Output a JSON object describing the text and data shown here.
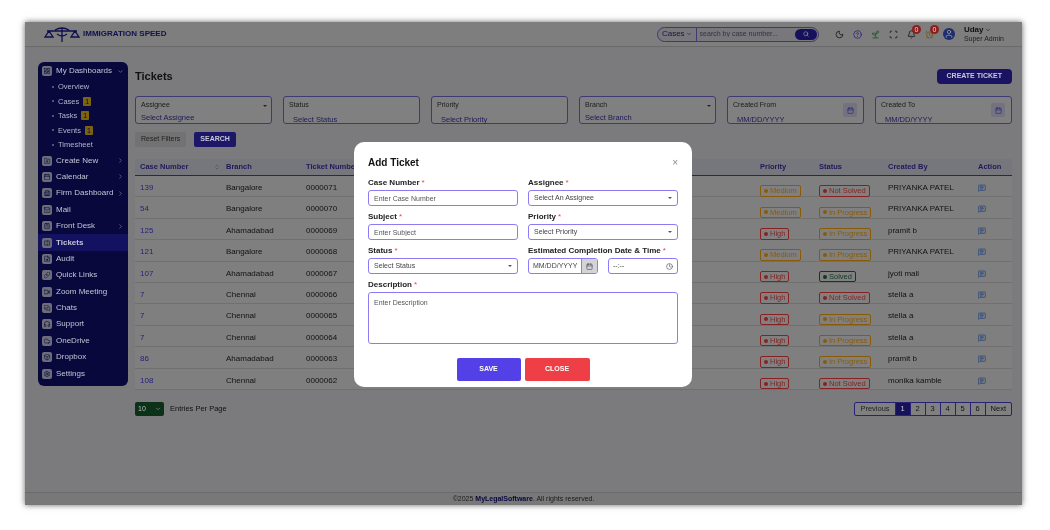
{
  "header": {
    "logo_text": "IMMIGRATION SPEED",
    "search": {
      "scope": "Cases",
      "placeholder": "search by case number..."
    },
    "notifications": {
      "bell_count": "0",
      "clock_count": "0"
    },
    "user": {
      "name": "Uday",
      "role": "Super Admin"
    }
  },
  "sidebar": {
    "items": [
      {
        "label": "My Dashboards",
        "kind": "menu",
        "expanded": true,
        "selected": false,
        "children": [
          {
            "label": "Overview"
          },
          {
            "label": "Cases",
            "count": "1"
          },
          {
            "label": "Tasks",
            "count": "1"
          },
          {
            "label": "Events",
            "count": "1"
          },
          {
            "label": "Timesheet"
          }
        ]
      },
      {
        "label": "Create New",
        "kind": "menu",
        "expanded": false,
        "selected": false
      },
      {
        "label": "Calendar",
        "kind": "menu",
        "expanded": false,
        "selected": false
      },
      {
        "label": "Firm Dashboard",
        "kind": "menu",
        "expanded": false,
        "selected": false
      },
      {
        "label": "Mail",
        "kind": "link",
        "selected": false
      },
      {
        "label": "Front Desk",
        "kind": "menu",
        "expanded": false,
        "selected": false
      },
      {
        "label": "Tickets",
        "kind": "link",
        "selected": true
      },
      {
        "label": "Audit",
        "kind": "link",
        "selected": false
      },
      {
        "label": "Quick Links",
        "kind": "link",
        "selected": false
      },
      {
        "label": "Zoom Meeting",
        "kind": "link",
        "selected": false
      },
      {
        "label": "Chats",
        "kind": "link",
        "selected": false
      },
      {
        "label": "Support",
        "kind": "link",
        "selected": false
      },
      {
        "label": "OneDrive",
        "kind": "link",
        "selected": false
      },
      {
        "label": "Dropbox",
        "kind": "link",
        "selected": false
      },
      {
        "label": "Settings",
        "kind": "link",
        "selected": false
      }
    ]
  },
  "page": {
    "title": "Tickets",
    "create_button": "CREATE TICKET"
  },
  "filters": [
    {
      "label": "Assignee",
      "value": "Select Assignee",
      "kind": "select"
    },
    {
      "label": "Status",
      "value": "Select Status",
      "kind": "plain"
    },
    {
      "label": "Priority",
      "value": "Select Priority",
      "kind": "plain"
    },
    {
      "label": "Branch",
      "value": "Select Branch",
      "kind": "select"
    },
    {
      "label": "Created From",
      "value": "MM/DD/YYYY",
      "kind": "date"
    },
    {
      "label": "Created To",
      "value": "MM/DD/YYYY",
      "kind": "date"
    }
  ],
  "filter_buttons": {
    "reset": "Reset Filters",
    "search": "SEARCH"
  },
  "table": {
    "columns": [
      "Case Number",
      "Branch",
      "Ticket Numbe",
      "Priority",
      "Status",
      "Created By",
      "Action"
    ],
    "rows": [
      {
        "case": "139",
        "branch": "Bangalore",
        "ticket": "0000071",
        "priority": {
          "text": "Medium",
          "color": "#8a5a08"
        },
        "status": {
          "text": "Not Solved",
          "color": "#882222"
        },
        "created_by": "PRIYANKA PATEL"
      },
      {
        "case": "54",
        "branch": "Bangalore",
        "ticket": "0000070",
        "priority": {
          "text": "Medium",
          "color": "#8a5a08"
        },
        "status": {
          "text": "In Progress",
          "color": "#8a5a08"
        },
        "created_by": "PRIYANKA PATEL"
      },
      {
        "case": "125",
        "branch": "Ahamadabad",
        "ticket": "0000069",
        "priority": {
          "text": "High",
          "color": "#882222"
        },
        "status": {
          "text": "In Progress",
          "color": "#8a5a08"
        },
        "created_by": "pramit b"
      },
      {
        "case": "121",
        "branch": "Bangalore",
        "ticket": "0000068",
        "priority": {
          "text": "Medium",
          "color": "#8a5a08"
        },
        "status": {
          "text": "In Progress",
          "color": "#8a5a08"
        },
        "created_by": "PRIYANKA PATEL"
      },
      {
        "case": "107",
        "branch": "Ahamadabad",
        "ticket": "0000067",
        "priority": {
          "text": "High",
          "color": "#882222"
        },
        "status": {
          "text": "Solved",
          "color": "#0e3a20"
        },
        "created_by": "jyoti mali"
      },
      {
        "case": "7",
        "branch": "Chennai",
        "ticket": "0000066",
        "priority": {
          "text": "High",
          "color": "#882222"
        },
        "status": {
          "text": "Not Solved",
          "color": "#882222"
        },
        "created_by": "stella a"
      },
      {
        "case": "7",
        "branch": "Chennai",
        "ticket": "0000065",
        "priority": {
          "text": "High",
          "color": "#882222"
        },
        "status": {
          "text": "In Progress",
          "color": "#8a5a08"
        },
        "created_by": "stella a"
      },
      {
        "case": "7",
        "branch": "Chennai",
        "ticket": "0000064",
        "priority": {
          "text": "High",
          "color": "#882222"
        },
        "status": {
          "text": "In Progress",
          "color": "#8a5a08"
        },
        "created_by": "stella a"
      },
      {
        "case": "86",
        "branch": "Ahamadabad",
        "ticket": "0000063",
        "priority": {
          "text": "High",
          "color": "#882222"
        },
        "status": {
          "text": "In Progress",
          "color": "#8a5a08"
        },
        "created_by": "pramit b"
      },
      {
        "case": "108",
        "branch": "Chennai",
        "ticket": "0000062",
        "priority": {
          "text": "High",
          "color": "#882222"
        },
        "status": {
          "text": "Not Solved",
          "color": "#882222"
        },
        "created_by": "monika kamble"
      }
    ]
  },
  "pagination": {
    "per_page": "10",
    "per_page_label": "Entries Per Page",
    "previous": "Previous",
    "next": "Next",
    "pages": [
      {
        "label": "1",
        "selected": true
      },
      {
        "label": "2",
        "selected": false
      },
      {
        "label": "3",
        "selected": false
      },
      {
        "label": "4",
        "selected": false
      },
      {
        "label": "5",
        "selected": false
      },
      {
        "label": "6",
        "selected": false
      }
    ]
  },
  "footer": "©2025 **MyLegalSoftware**. All rights reserved.",
  "modal": {
    "title": "Add Ticket",
    "close_icon": "×",
    "fields": [
      {
        "label": "Case Number",
        "required_mark": "*",
        "kind": "input",
        "placeholder": "Enter Case Number"
      },
      {
        "label": "Assignee",
        "required_mark": "*",
        "kind": "select",
        "value": "Select An Assignee"
      },
      {
        "label": "Subject",
        "required_mark": "*",
        "kind": "input",
        "placeholder": "Enter Subject"
      },
      {
        "label": "Priority",
        "required_mark": "*",
        "kind": "select",
        "value": "Select Priority"
      },
      {
        "label": "Status",
        "required_mark": "*",
        "kind": "select",
        "value": "Select Status"
      },
      {
        "label": "Estimated Completion Date & Time",
        "required_mark": "*",
        "kind": "datetime",
        "date_placeholder": "MM/DD/YYYY",
        "time_placeholder": "--:--"
      },
      {
        "label": "Description",
        "required_mark": "*",
        "kind": "textarea",
        "placeholder": "Enter Description"
      }
    ],
    "buttons": [
      {
        "label": "SAVE",
        "kind": "primary"
      },
      {
        "label": "CLOSE",
        "kind": "danger"
      }
    ]
  }
}
